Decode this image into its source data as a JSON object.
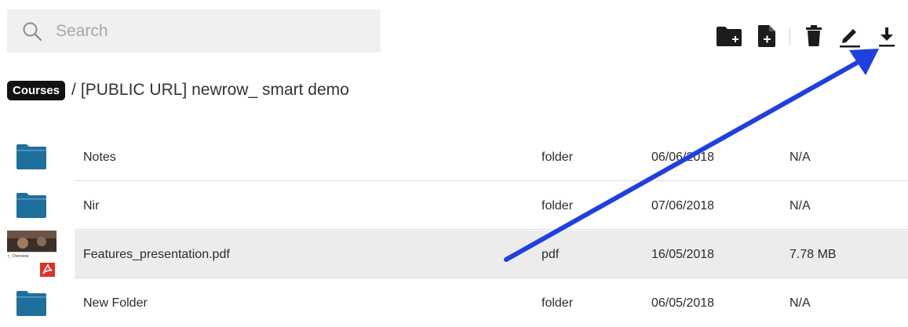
{
  "search": {
    "placeholder": "Search",
    "value": ""
  },
  "toolbar": {
    "icons": [
      "add-folder-icon",
      "add-file-icon",
      "trash-icon",
      "edit-icon",
      "download-icon"
    ]
  },
  "breadcrumb": {
    "root": "Courses",
    "separator": "/",
    "current": "[PUBLIC URL] newrow_ smart demo"
  },
  "files": [
    {
      "name": "Notes",
      "type": "folder",
      "date": "06/06/2018",
      "size": "N/A",
      "icon": "folder-icon"
    },
    {
      "name": "Nir",
      "type": "folder",
      "date": "07/06/2018",
      "size": "N/A",
      "icon": "folder-icon"
    },
    {
      "name": "Features_presentation.pdf",
      "type": "pdf",
      "date": "16/05/2018",
      "size": "7.78 MB",
      "icon": "pdf-thumbnail",
      "thumb_caption": "r_ Overview",
      "selected": true
    },
    {
      "name": "New Folder",
      "type": "folder",
      "date": "06/05/2018",
      "size": "N/A",
      "icon": "folder-icon"
    }
  ],
  "colors": {
    "folder": "#1f6f9c",
    "annotation_arrow": "#1f3fe0",
    "selected_row": "#ececec",
    "pdf_red": "#e0312a"
  }
}
